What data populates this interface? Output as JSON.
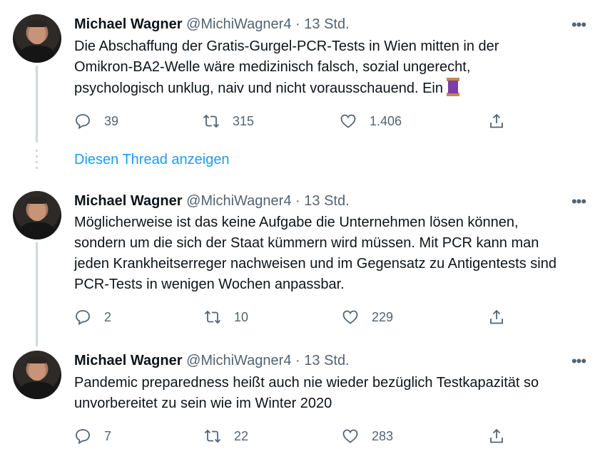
{
  "tweets": [
    {
      "name": "Michael Wagner",
      "handle": "@MichiWagner4",
      "sep": "·",
      "time": "13 Std.",
      "more": "•••",
      "lines": [
        "Die Abschaffung der Gratis-Gurgel-PCR-Tests in Wien mitten in der",
        "Omikron-BA2-Welle wäre medizinisch falsch, sozial ungerecht,",
        "psychologisch unklug, naiv und nicht vorausschauend.  Ein"
      ],
      "replies": "39",
      "retweets": "315",
      "likes": "1.406"
    },
    {
      "name": "Michael Wagner",
      "handle": "@MichiWagner4",
      "sep": "·",
      "time": "13 Std.",
      "more": "•••",
      "lines": [
        "Möglicherweise ist das keine Aufgabe die Unternehmen lösen können,",
        "sondern um die sich der Staat kümmern wird müssen. Mit PCR kann man",
        "jeden Krankheitserreger nachweisen und im Gegensatz zu Antigentests sind",
        "PCR-Tests in wenigen Wochen anpassbar."
      ],
      "replies": "2",
      "retweets": "10",
      "likes": "229"
    },
    {
      "name": "Michael Wagner",
      "handle": "@MichiWagner4",
      "sep": "·",
      "time": "13 Std.",
      "more": "•••",
      "lines": [
        "Pandemic preparedness heißt auch nie wieder bezüglich Testkapazität so",
        "unvorbereitet zu sein wie im Winter 2020"
      ],
      "replies": "7",
      "retweets": "22",
      "likes": "283"
    }
  ],
  "show_thread_label": "Diesen Thread anzeigen",
  "icons": {
    "reply": "reply-icon",
    "retweet": "retweet-icon",
    "like": "like-icon",
    "share": "share-icon",
    "thread": "thread-emoji-icon"
  },
  "colors": {
    "link": "#1d9bf0",
    "secondary_text": "#536471",
    "thread_line": "#cfd9de"
  }
}
